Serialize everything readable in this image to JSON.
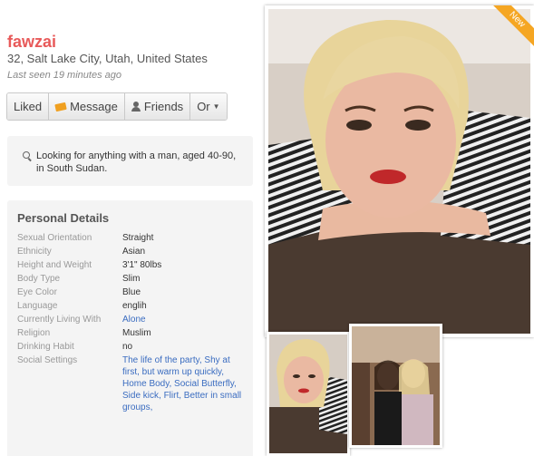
{
  "profile": {
    "name": "fawzai",
    "location": "32, Salt Lake City, Utah, United States",
    "last_seen": "Last seen 19 minutes ago"
  },
  "actions": {
    "liked": "Liked",
    "message": "Message",
    "friends": "Friends",
    "or": "Or"
  },
  "looking_for": "Looking for anything with a man, aged 40-90, in South Sudan.",
  "details": {
    "title": "Personal Details",
    "rows": [
      {
        "label": "Sexual Orientation",
        "value": "Straight"
      },
      {
        "label": "Ethnicity",
        "value": "Asian"
      },
      {
        "label": "Height and Weight",
        "value": "3'1\" 80lbs"
      },
      {
        "label": "Body Type",
        "value": "Slim"
      },
      {
        "label": "Eye Color",
        "value": "Blue"
      },
      {
        "label": "Language",
        "value": "englih"
      },
      {
        "label": "Currently Living With",
        "value": "Alone"
      },
      {
        "label": "Religion",
        "value": "Muslim"
      },
      {
        "label": "Drinking Habit",
        "value": "no"
      },
      {
        "label": "Social Settings",
        "value": "The life of the party, Shy at first, but warm up quickly, Home Body, Social Butterfly, Side kick, Flirt, Better in small groups,"
      }
    ]
  },
  "photo": {
    "badge": "New"
  },
  "colors": {
    "name": "#e85a5a",
    "link": "#3a6cc0",
    "badge": "#f5a623"
  }
}
